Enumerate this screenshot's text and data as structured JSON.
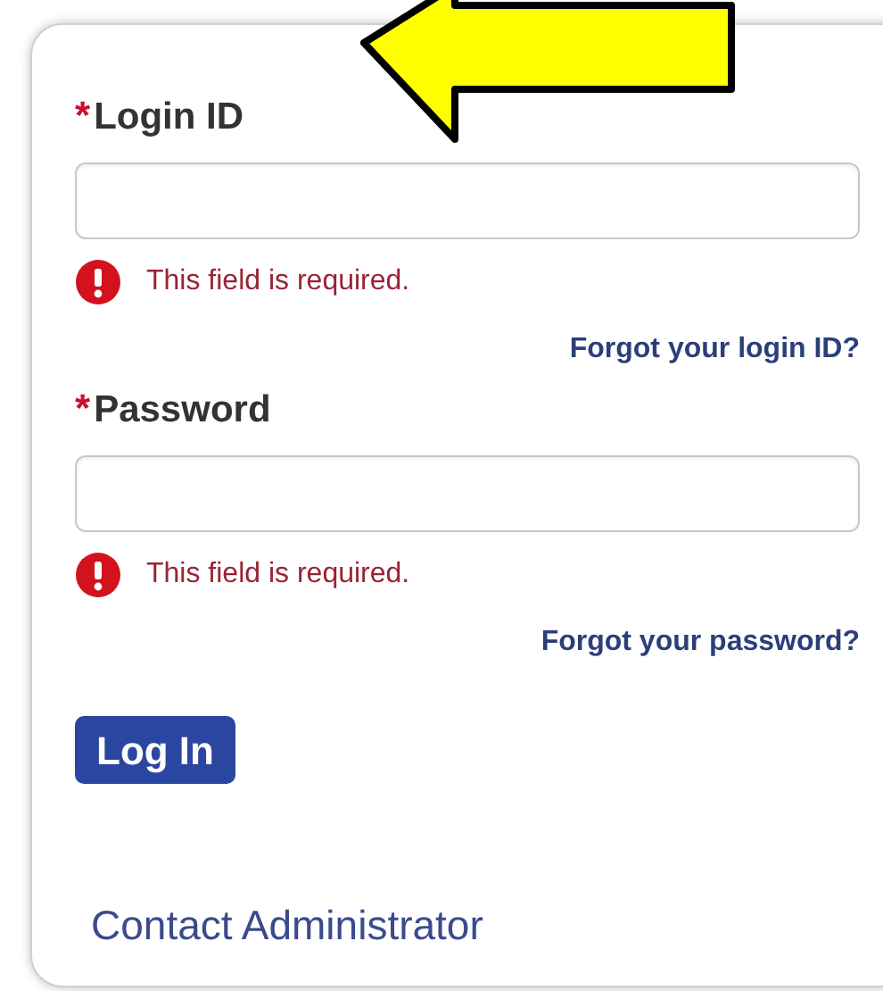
{
  "fields": [
    {
      "label": "Login ID",
      "required_mark": "*",
      "required": true,
      "error": "This field is required.",
      "link": "Forgot your login ID?"
    },
    {
      "label": "Password",
      "required_mark": "*",
      "required": true,
      "error": "This field is required.",
      "link": "Forgot your password?"
    }
  ],
  "login_button": "Log In",
  "contact_link": "Contact Administrator"
}
